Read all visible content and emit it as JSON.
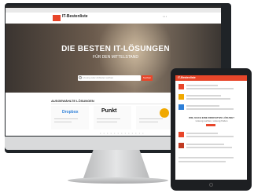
{
  "brand": {
    "name": "IT-Bestenliste",
    "accent": "#e8462a"
  },
  "hero": {
    "title": "DIE BESTEN IT-LÖSUNGEN",
    "subtitle": "FÜR DEN MITTELSTAND",
    "search_placeholder": "Lösung oder Anbieter suchen",
    "search_button": "Suchen"
  },
  "section": {
    "title": "AUSGEWÄHLTE LÖSUNGEN"
  },
  "cards": [
    {
      "logo": "Dropbox",
      "color": "#2d7fd8"
    },
    {
      "logo": "Punkt",
      "color": "#111111"
    },
    {
      "logo": "",
      "color": "#f0a800"
    }
  ],
  "tablet": {
    "logo": "IT-Bestenliste",
    "heading_line1": "WIE, NACH EINE INNOVATIVE LÖSUNG?",
    "heading_line2": "Lösung suchen, Lösung finden"
  }
}
